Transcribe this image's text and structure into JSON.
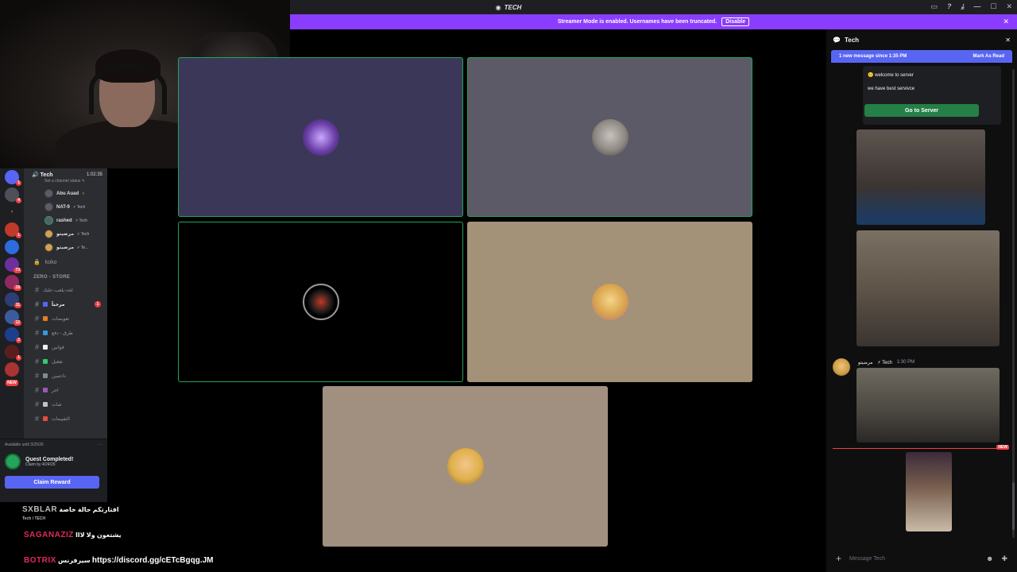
{
  "window": {
    "title": "TECH",
    "controls": [
      "▭",
      "?",
      "⤓",
      "—",
      "☐",
      "✕"
    ]
  },
  "banner": {
    "text": "Streamer Mode is enabled. Usernames have been truncated.",
    "disable_label": "Disable",
    "close": "✕"
  },
  "sidebar": {
    "voice_channel": {
      "name": "Tech",
      "time": "1:02:35",
      "status": "Set a channel status ✎"
    },
    "members": [
      {
        "name": "Abu Auad",
        "tag": "⚡"
      },
      {
        "name": "NAT-9",
        "tag": "⚡ Tech"
      },
      {
        "name": "rashed",
        "tag": "⚡ Tech"
      },
      {
        "name": "مرضيتو",
        "tag": "⚡ Tech"
      },
      {
        "name": "مرضيتو",
        "tag": "⚡ Te..."
      }
    ],
    "locked_channel": "koko",
    "category": "ZERO - STORE",
    "channels": [
      {
        "label": "لحد-يلعب-عليك",
        "unread": false,
        "badge": ""
      },
      {
        "label": "مرحبآ",
        "unread": true,
        "badge": "1"
      },
      {
        "label": "تعويضات",
        "unread": false,
        "badge": ""
      },
      {
        "label": "طرق - دفع",
        "unread": false,
        "badge": ""
      },
      {
        "label": "قوانين",
        "unread": false,
        "badge": ""
      },
      {
        "label": "تفعيل",
        "unread": false,
        "badge": ""
      },
      {
        "label": "داعمين",
        "unread": false,
        "badge": ""
      },
      {
        "label": "اجر",
        "unread": false,
        "badge": ""
      },
      {
        "label": "شات",
        "unread": false,
        "badge": ""
      },
      {
        "label": "التقييمات",
        "unread": false,
        "badge": ""
      }
    ]
  },
  "rail": {
    "new_label": "NEW",
    "badges": [
      "1",
      "4",
      "1",
      "73",
      "19",
      "11",
      "12",
      "2",
      "1"
    ]
  },
  "quest": {
    "available": "Available until 3/25/26",
    "more": "···",
    "title": "Quest Completed!",
    "subtitle": "Claim by 4/24/26",
    "claim_label": "Claim Reward"
  },
  "overlay": {
    "brand1": "SXBLAR",
    "line1": "افتارتكم حالة خاصة",
    "sub1": "Tech / TECH",
    "brand2": "SAGANAZIZ",
    "line2": "يشتعون ولا لااا",
    "brand3": "BOTRIX",
    "line3": "سيرفرنس",
    "link": "https://discord.gg/cETcBgqg.JM"
  },
  "chat": {
    "title": "Tech",
    "close": "✕",
    "new_messages": "1 new message since 1:35 PM",
    "mark_read": "Mark As Read",
    "embed_line1": "welcome to server",
    "embed_line2": "we have best servivce",
    "goto_label": "Go to Server",
    "msg_author": "مرضيتو",
    "msg_tag": "⚡ Tech",
    "msg_time": "1:30 PM",
    "new_pill": "NEW",
    "composer_placeholder": "Message Tech"
  },
  "colors": {
    "speaking_border": "#23a55a",
    "banner": "#8b3dff",
    "blurple": "#5865f2"
  }
}
